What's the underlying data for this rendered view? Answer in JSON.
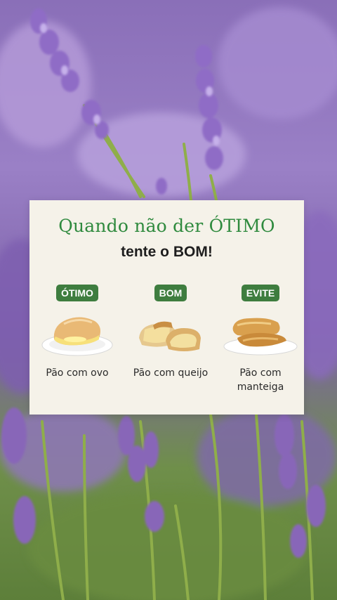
{
  "colors": {
    "title_green": "#2f8a3e",
    "badge_green": "#3e7d3f",
    "card_bg": "#f5f2e9",
    "lavender": "#9a80c6"
  },
  "card": {
    "title_line1": "Quando não der ÓTIMO",
    "title_line2": "tente o BOM!"
  },
  "columns": [
    {
      "badge": "ÓTIMO",
      "label": "Pão com ovo",
      "icon": "bread-with-egg-icon"
    },
    {
      "badge": "BOM",
      "label": "Pão com queijo",
      "icon": "bread-with-cheese-icon"
    },
    {
      "badge": "EVITE",
      "label": "Pão com manteiga",
      "icon": "bread-with-butter-icon"
    }
  ]
}
